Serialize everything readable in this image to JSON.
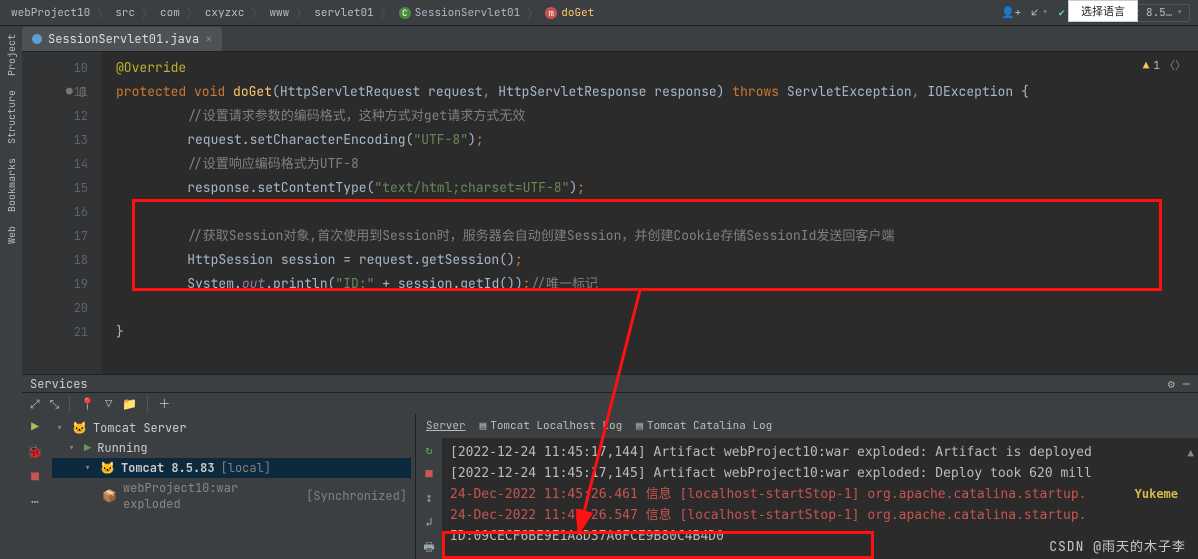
{
  "breadcrumbs": [
    "webProject10",
    "src",
    "com",
    "cxyzxc",
    "www",
    "servlet01"
  ],
  "breadcrumb_class": "SessionServlet01",
  "breadcrumb_method": "doGet",
  "topbar": {
    "run_dropdown": "Tomcat 8.5…",
    "user_icon_name": "add-user-icon"
  },
  "lang_popup": "选择语言",
  "tab": {
    "filename": "SessionServlet01.java"
  },
  "editor": {
    "warning_count": "1",
    "lines": [
      {
        "n": "10",
        "html": "<span class='ann'>@Override</span>"
      },
      {
        "n": "11",
        "html": "<span class='kw'>protected void</span> <span class='mtd'>doGet</span>(<span class='typ'>HttpServletRequest</span> request<span class='punc'>,</span> <span class='typ'>HttpServletResponse</span> response) <span class='kw'>throws</span> <span class='typ'>ServletException</span><span class='punc'>,</span> <span class='typ'>IOException</span> {"
      },
      {
        "n": "12",
        "html": "    <span class='cmt'>//设置请求参数的编码格式，这种方式对get请求方式无效</span>"
      },
      {
        "n": "13",
        "html": "    request.setCharacterEncoding(<span class='str'>\"UTF-8\"</span>)<span class='punc'>;</span>"
      },
      {
        "n": "14",
        "html": "    <span class='cmt'>//设置响应编码格式为UTF-8</span>"
      },
      {
        "n": "15",
        "html": "    response.setContentType(<span class='str'>\"text/html;charset=UTF-8\"</span>)<span class='punc'>;</span>"
      },
      {
        "n": "16",
        "html": ""
      },
      {
        "n": "17",
        "html": "    <span class='cmt'>//获取Session对象,首次使用到Session时，服务器会自动创建Session，并创建Cookie存储SessionId发送回客户端</span>"
      },
      {
        "n": "18",
        "html": "    <span class='typ'>HttpSession</span> session = request.getSession()<span class='punc'>;</span>"
      },
      {
        "n": "19",
        "html": "    System.<span class='field'>out</span>.println(<span class='str'>\"ID:\"</span> + session.getId())<span class='punc'>;</span><span class='cmt'>//唯一标记</span>"
      },
      {
        "n": "20",
        "html": ""
      },
      {
        "n": "21",
        "html": "}"
      }
    ]
  },
  "services": {
    "title": "Services",
    "tabs": {
      "server": "Server",
      "local_log": "Tomcat Localhost Log",
      "catalina_log": "Tomcat Catalina Log"
    },
    "tree": {
      "root": "Tomcat Server",
      "running": "Running",
      "config": "Tomcat 8.5.83",
      "config_tag": "[local]",
      "artifact": "webProject10:war exploded",
      "artifact_state": "[Synchronized]"
    },
    "console": [
      {
        "cls": "log-norm",
        "text": "[2022-12-24 11:45:17,144] Artifact webProject10:war exploded: Artifact is deployed"
      },
      {
        "cls": "log-norm",
        "text": "[2022-12-24 11:45:17,145] Artifact webProject10:war exploded: Deploy took 620 mill"
      },
      {
        "cls": "log-red",
        "text": "24-Dec-2022 11:45:26.461 信息 [localhost-startStop-1] org.apache.catalina.startup."
      },
      {
        "cls": "log-red",
        "text": "24-Dec-2022 11:45:26.547 信息 [localhost-startStop-1] org.apache.catalina.startup."
      },
      {
        "cls": "log-norm",
        "text": "ID:09CECF6BE9E1A8D37A6FCE9B80C4B4D0"
      }
    ],
    "yellow_watermark": "Yukeme"
  },
  "leftstrip": {
    "project": "Project",
    "structure": "Structure",
    "bookmarks": "Bookmarks",
    "web": "Web"
  },
  "watermark": "CSDN @雨天的木子李"
}
